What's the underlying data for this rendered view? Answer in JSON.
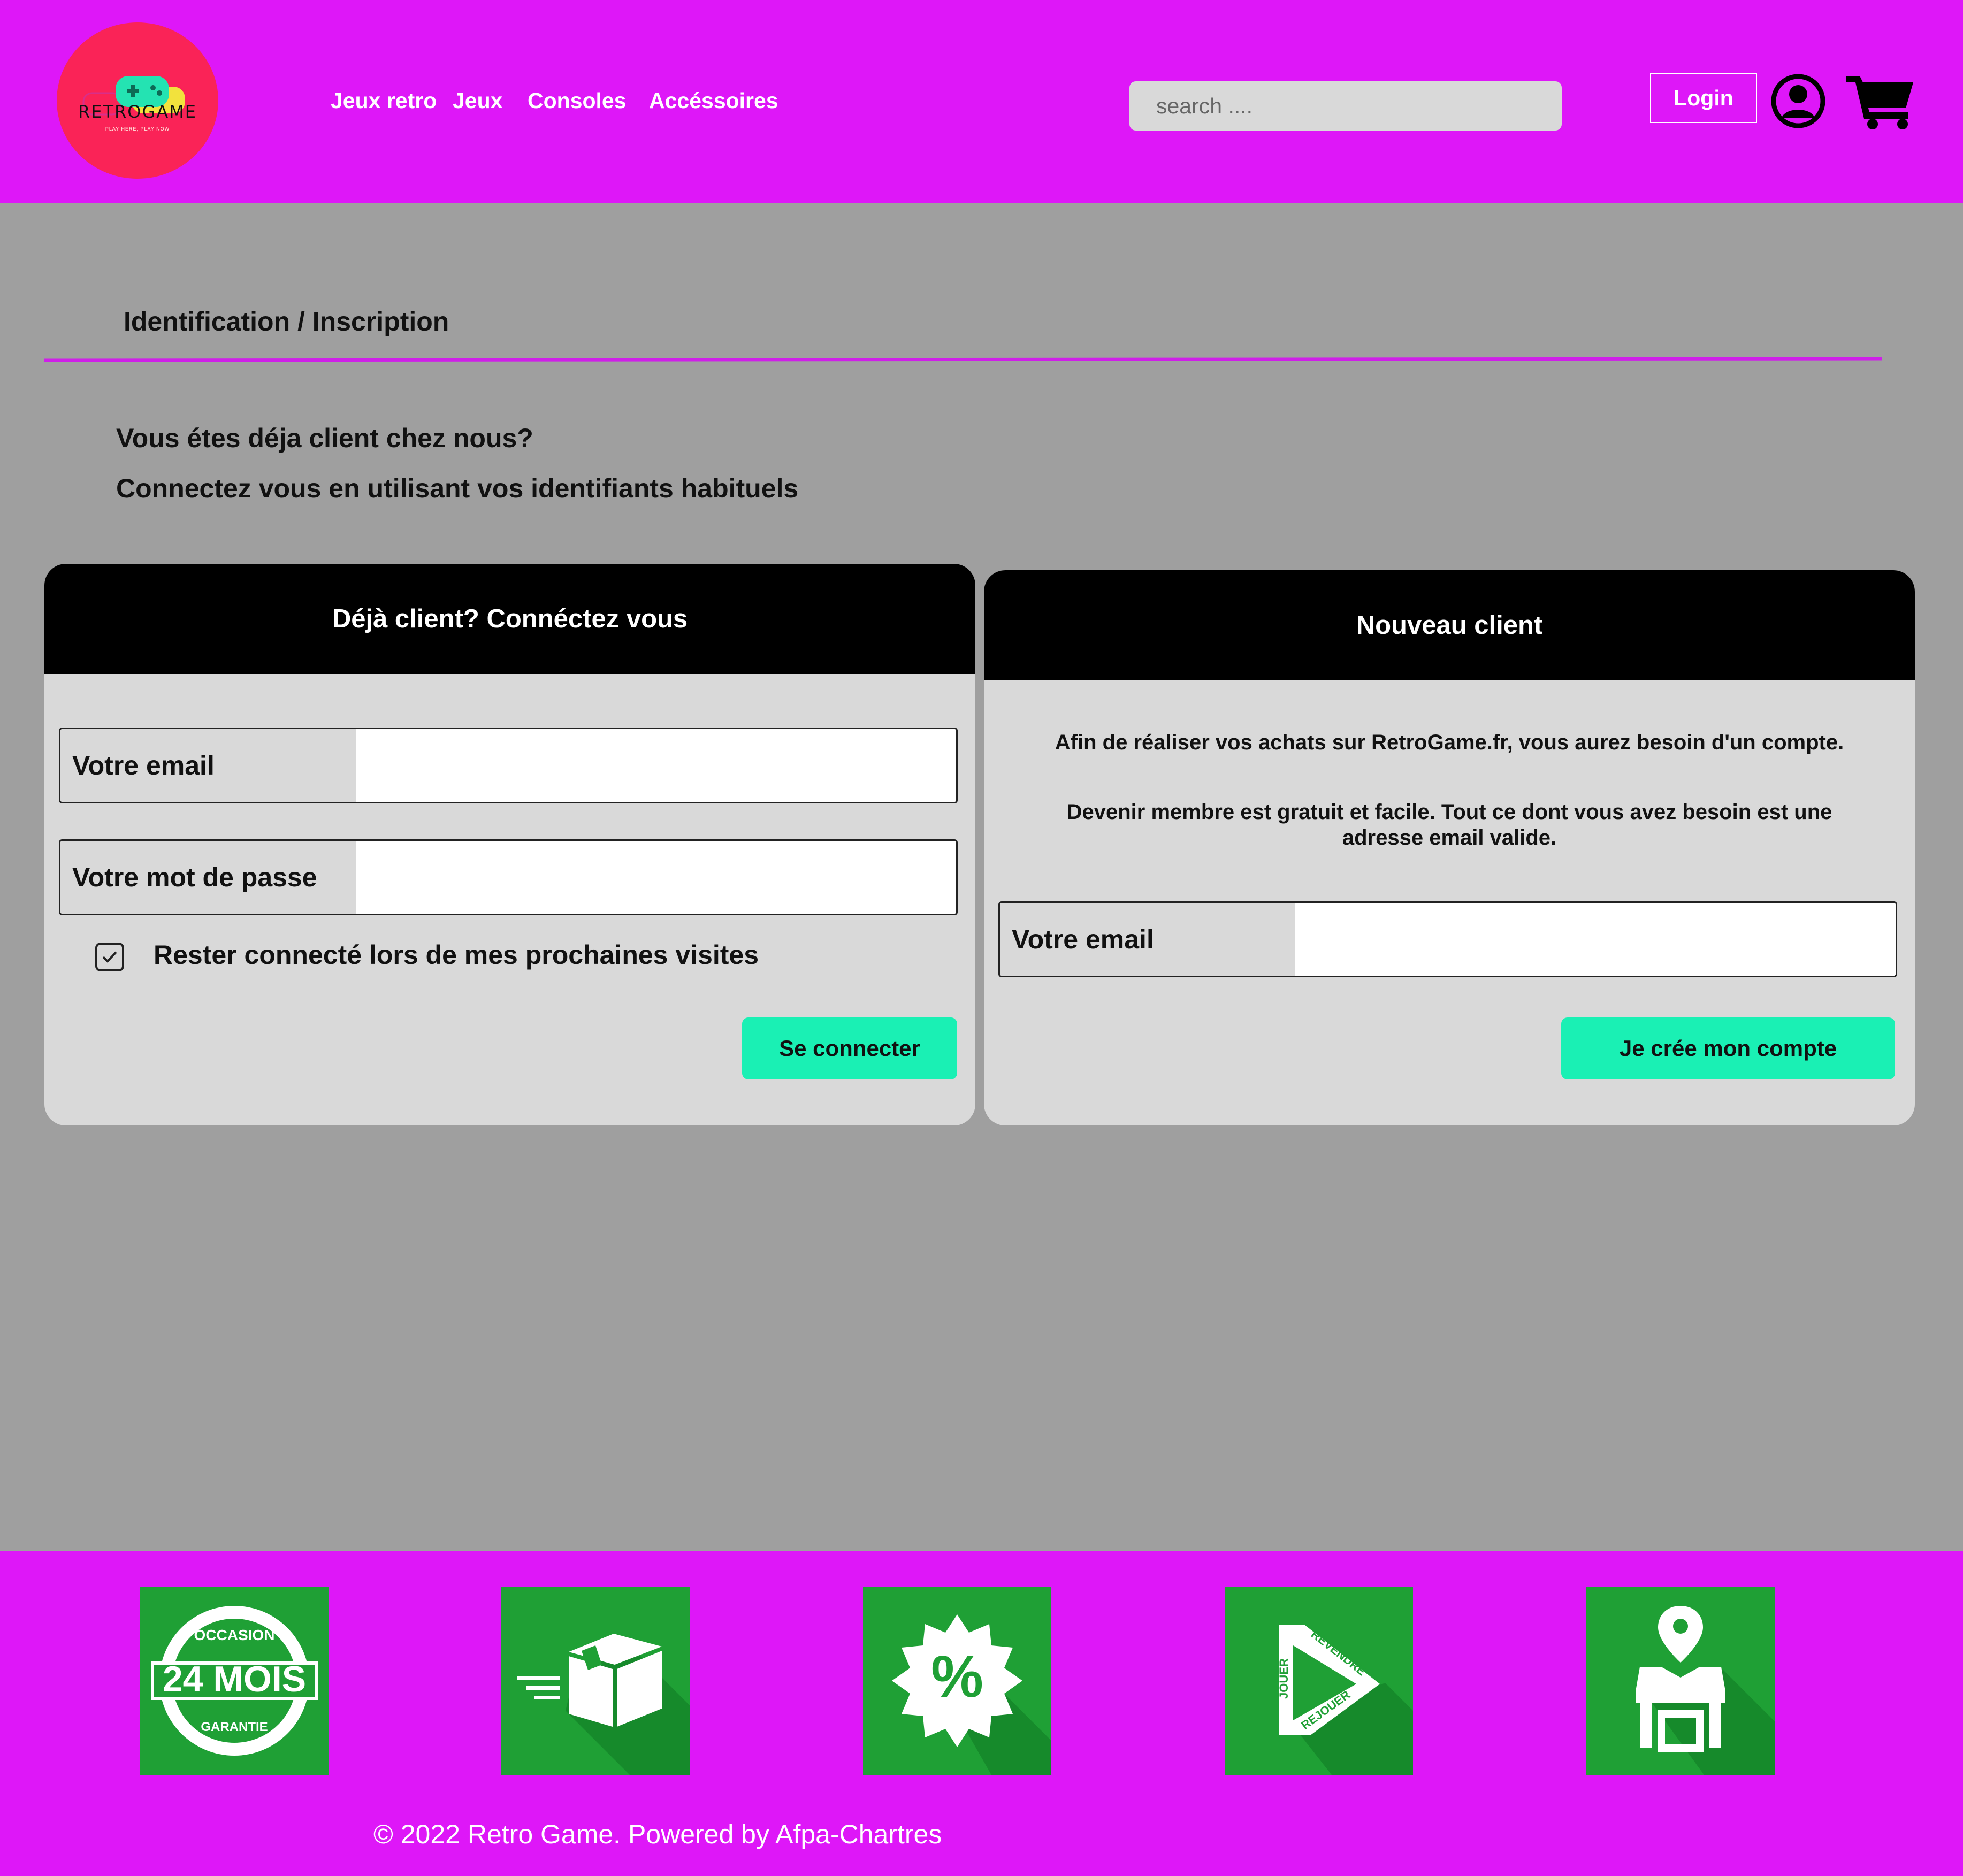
{
  "header": {
    "logo": {
      "name": "RETROGAME",
      "tagline": "PLAY HERE, PLAY NOW"
    },
    "nav": [
      {
        "label": "Jeux retro"
      },
      {
        "label": "Jeux"
      },
      {
        "label": "Consoles"
      },
      {
        "label": "Accéssoires"
      }
    ],
    "search": {
      "placeholder": "search ...."
    },
    "login_label": "Login",
    "icons": [
      "user-circle-icon",
      "shopping-cart-icon"
    ]
  },
  "main": {
    "title": "Identification  / Inscription",
    "intro_line1": "Vous étes déja client chez nous?",
    "intro_line2": "Connectez vous en utilisant vos identifiants habituels",
    "login_panel": {
      "heading": "Déjà client? Connéctez vous",
      "email_label": "Votre email",
      "password_label": "Votre mot de passe",
      "remember_label": "Rester connecté lors de mes prochaines visites",
      "remember_checked": true,
      "submit_label": "Se connecter"
    },
    "register_panel": {
      "heading": "Nouveau client",
      "text1": "Afin de réaliser vos achats sur RetroGame.fr, vous aurez besoin d'un compte.",
      "text2_line1": "Devenir membre est gratuit et facile. Tout ce dont vous avez besoin est une",
      "text2_line2": "adresse email valide.",
      "email_label": "Votre email",
      "submit_label": "Je crée mon compte"
    }
  },
  "footer": {
    "badge_24": {
      "top": "OCCASION",
      "main": "24 MOIS",
      "bottom": "GARANTIE"
    },
    "badge_loop": {
      "a": "JOUER",
      "b": "REVENDRE",
      "c": "REJOUER"
    },
    "tile_icons": [
      "guarantee-24-months-icon",
      "fast-delivery-box-icon",
      "discount-percent-icon",
      "play-resell-replay-icon",
      "store-location-icon"
    ],
    "copyright": "© 2022 Retro Game. Powered by Afpa-Chartres"
  },
  "colors": {
    "brand_magenta": "#de17f8",
    "logo_red": "#fa2357",
    "action_green": "#1af0b4",
    "tile_green": "#1fa035",
    "page_grey": "#9f9f9f"
  }
}
